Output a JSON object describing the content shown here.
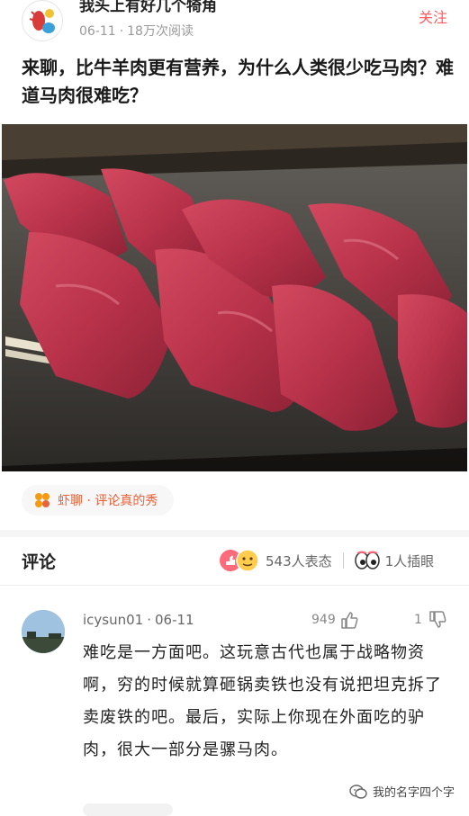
{
  "post": {
    "author": "我头上有好几个犄角",
    "date": "06-11",
    "views": "18万次阅读",
    "follow_label": "关注",
    "title": "来聊，比牛羊肉更有营养，为什么人类很少吃马肉？难道马肉很难吃？"
  },
  "topic": {
    "label": "虾聊 · 评论真的秀",
    "icon": "shrimp-talk-icon"
  },
  "comments_section": {
    "title": "评论",
    "reaction_count": "543人表态",
    "eye_count": "1人插眼"
  },
  "comment": {
    "username": "icysun01",
    "date": "06-11",
    "likes": "949",
    "dislikes": "1",
    "text": "难吃是一方面吧。这玩意古代也属于战略物资啊，穷的时候就算砸锅卖铁也没有说把坦克拆了卖废铁的吧。最后，实际上你现在外面吃的驴肉，很大一部分是骡马肉。"
  },
  "watermark": {
    "text": "我的名字四个字",
    "icon": "wechat-icon"
  },
  "colors": {
    "accent": "#ff5a5f",
    "topic": "#e8623c",
    "meat": "#b8324a"
  }
}
